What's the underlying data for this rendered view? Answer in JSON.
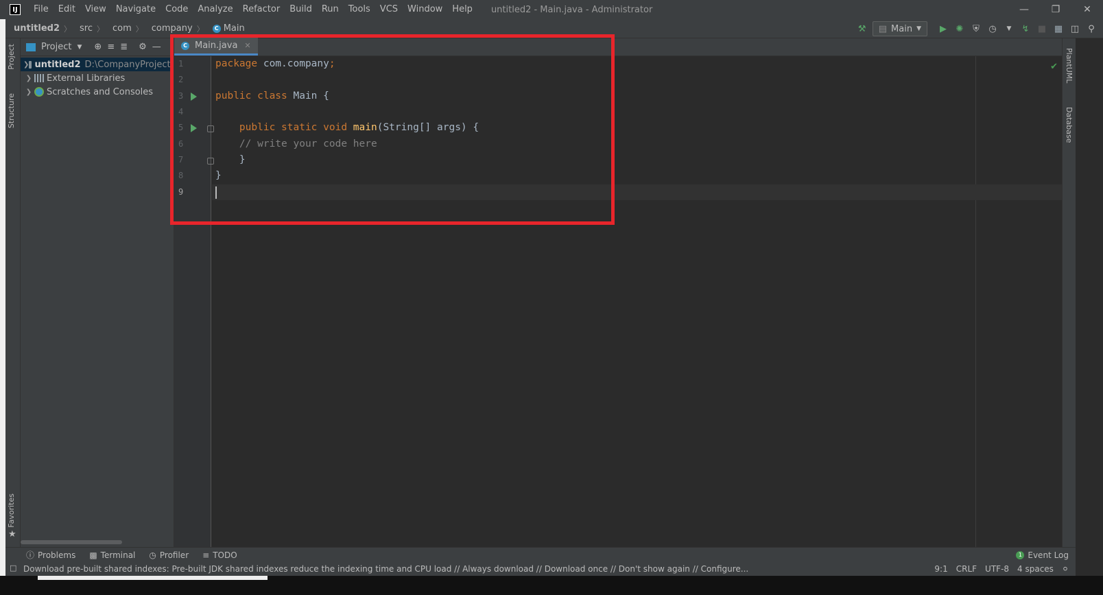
{
  "titlebar": {
    "menu": [
      "File",
      "Edit",
      "View",
      "Navigate",
      "Code",
      "Analyze",
      "Refactor",
      "Build",
      "Run",
      "Tools",
      "VCS",
      "Window",
      "Help"
    ],
    "window_title": "untitled2 - Main.java - Administrator",
    "logo_text": "IJ"
  },
  "breadcrumb": {
    "items": [
      "untitled2",
      "src",
      "com",
      "company"
    ],
    "current": "Main"
  },
  "toolbar": {
    "run_config": "Main"
  },
  "sidebar_left": {
    "tabs": [
      "Project",
      "Structure",
      "Favorites"
    ]
  },
  "project_panel": {
    "title": "Project",
    "tree": [
      {
        "label": "untitled2",
        "path": "D:\\CompanyProject\\",
        "selected": true
      },
      {
        "label": "External Libraries"
      },
      {
        "label": "Scratches and Consoles"
      }
    ]
  },
  "editor": {
    "tab_label": "Main.java",
    "line_numbers": [
      "1",
      "2",
      "3",
      "4",
      "5",
      "6",
      "7",
      "8",
      "9"
    ],
    "cursor_line": 9
  },
  "sidebar_right": {
    "tabs": [
      "PlantUML",
      "Database"
    ]
  },
  "bottom_tools": {
    "items": [
      "Problems",
      "Terminal",
      "Profiler",
      "TODO"
    ],
    "event_log": "Event Log",
    "event_count": "1"
  },
  "statusbar": {
    "message": "Download pre-built shared indexes: Pre-built JDK shared indexes reduce the indexing time and CPU load // Always download // Download once // Don't show again // Configure...",
    "position": "9:1",
    "line_sep": "CRLF",
    "encoding": "UTF-8",
    "indent": "4 spaces"
  },
  "colors": {
    "keyword": "#cc7832",
    "comment": "#808080",
    "function": "#ffc66d",
    "highlight_box": "#e8252b"
  }
}
